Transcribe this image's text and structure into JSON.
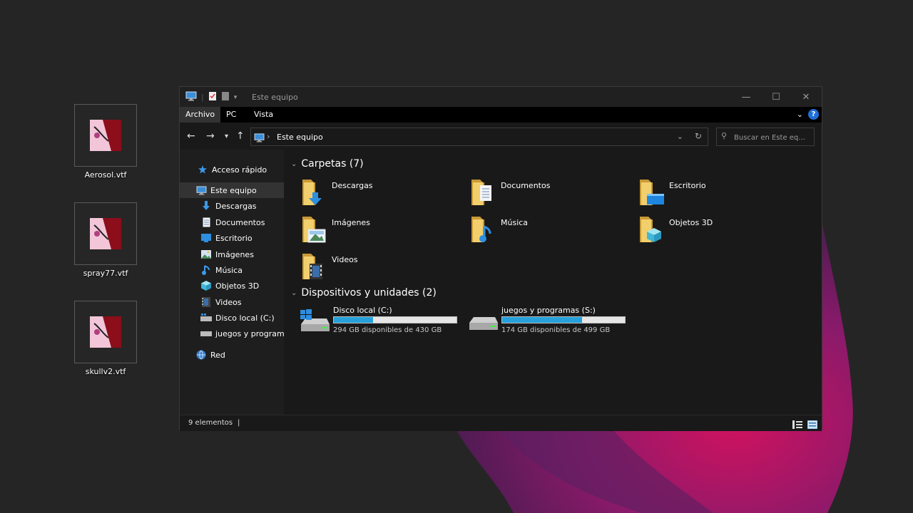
{
  "desktop": {
    "icons": [
      {
        "label": "Aerosol.vtf"
      },
      {
        "label": "spray77.vtf"
      },
      {
        "label": "skullv2.vtf"
      }
    ]
  },
  "window": {
    "title": "Este equipo",
    "ribbon": {
      "tabs": [
        "Archivo",
        "PC",
        "Vista"
      ],
      "help": "?"
    },
    "address": {
      "path": "Este equipo"
    },
    "search": {
      "placeholder": "Buscar en Este eq..."
    },
    "nav": {
      "items": [
        {
          "label": "Acceso rápido",
          "icon": "star-icon"
        },
        {
          "label": "Este equipo",
          "icon": "computer-icon"
        },
        {
          "label": "Descargas",
          "icon": "download-icon"
        },
        {
          "label": "Documentos",
          "icon": "document-icon"
        },
        {
          "label": "Escritorio",
          "icon": "desktop-icon"
        },
        {
          "label": "Imágenes",
          "icon": "picture-icon"
        },
        {
          "label": "Música",
          "icon": "music-icon"
        },
        {
          "label": "Objetos 3D",
          "icon": "cube-icon"
        },
        {
          "label": "Videos",
          "icon": "video-icon"
        },
        {
          "label": "Disco local (C:)",
          "icon": "drive-icon"
        },
        {
          "label": "juegos y programas",
          "icon": "drive-icon"
        },
        {
          "label": "Red",
          "icon": "network-icon"
        }
      ]
    },
    "folders": {
      "heading": "Carpetas (7)",
      "items": [
        {
          "label": "Descargas",
          "icon": "download-folder-icon"
        },
        {
          "label": "Documentos",
          "icon": "documents-folder-icon"
        },
        {
          "label": "Escritorio",
          "icon": "desktop-folder-icon"
        },
        {
          "label": "Imágenes",
          "icon": "pictures-folder-icon"
        },
        {
          "label": "Música",
          "icon": "music-folder-icon"
        },
        {
          "label": "Objetos 3D",
          "icon": "3d-objects-folder-icon"
        },
        {
          "label": "Videos",
          "icon": "videos-folder-icon"
        }
      ]
    },
    "drives": {
      "heading": "Dispositivos y unidades (2)",
      "items": [
        {
          "name": "Disco local (C:)",
          "free": "294 GB disponibles de 430 GB",
          "used_fraction": 0.32
        },
        {
          "name": "juegos y programas (S:)",
          "free": "174 GB disponibles de 499 GB",
          "used_fraction": 0.65
        }
      ]
    },
    "status": {
      "count": "9 elementos",
      "divider": "|"
    }
  },
  "colors": {
    "accent": "#26a0da",
    "help": "#1f6fd8",
    "folder": "#e8c15a"
  }
}
